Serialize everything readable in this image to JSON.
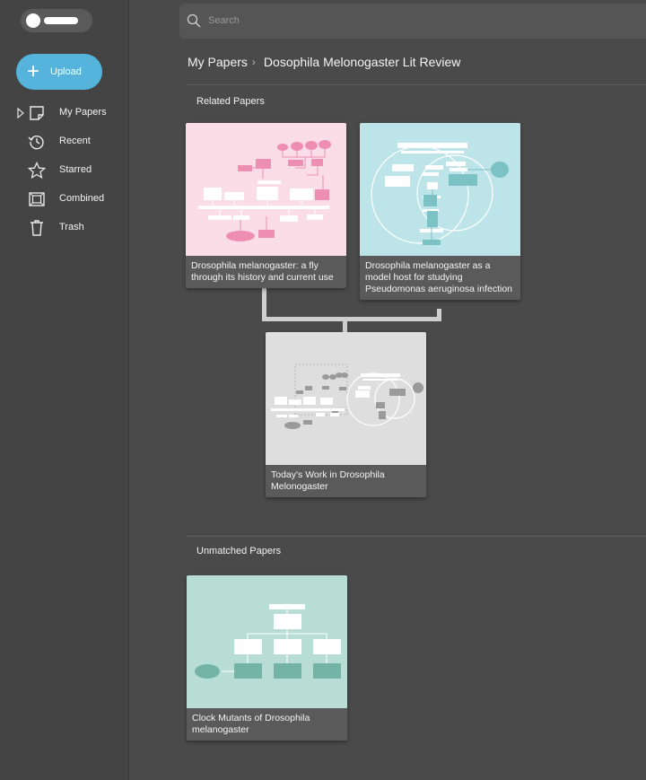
{
  "sidebar": {
    "upload_label": "Upload",
    "items": [
      {
        "label": "My Papers",
        "icon": "note-icon"
      },
      {
        "label": "Recent",
        "icon": "history-icon"
      },
      {
        "label": "Starred",
        "icon": "star-icon"
      },
      {
        "label": "Combined",
        "icon": "combined-icon"
      },
      {
        "label": "Trash",
        "icon": "trash-icon"
      }
    ]
  },
  "search": {
    "placeholder": "Search"
  },
  "breadcrumb": {
    "root": "My Papers",
    "current": "Dosophila Melonogaster Lit Review"
  },
  "sections": {
    "related": "Related Papers",
    "unmatched": "Unmatched Papers"
  },
  "cards": {
    "card1": {
      "title": "Drosophila melanogaster: a fly through its history and current use",
      "thumb_color": "#fbdde8"
    },
    "card2": {
      "title": "Drosophila melanogaster as a model host for studying Pseudomonas aeruginosa infection",
      "thumb_color": "#bde4e9"
    },
    "combined": {
      "title": "Today's Work in Drosophila Melonogaster",
      "thumb_color": "#dedede"
    },
    "unmatched1": {
      "title": "Clock Mutants of Drosophila melanogaster",
      "thumb_color": "#b7ddd4"
    }
  }
}
